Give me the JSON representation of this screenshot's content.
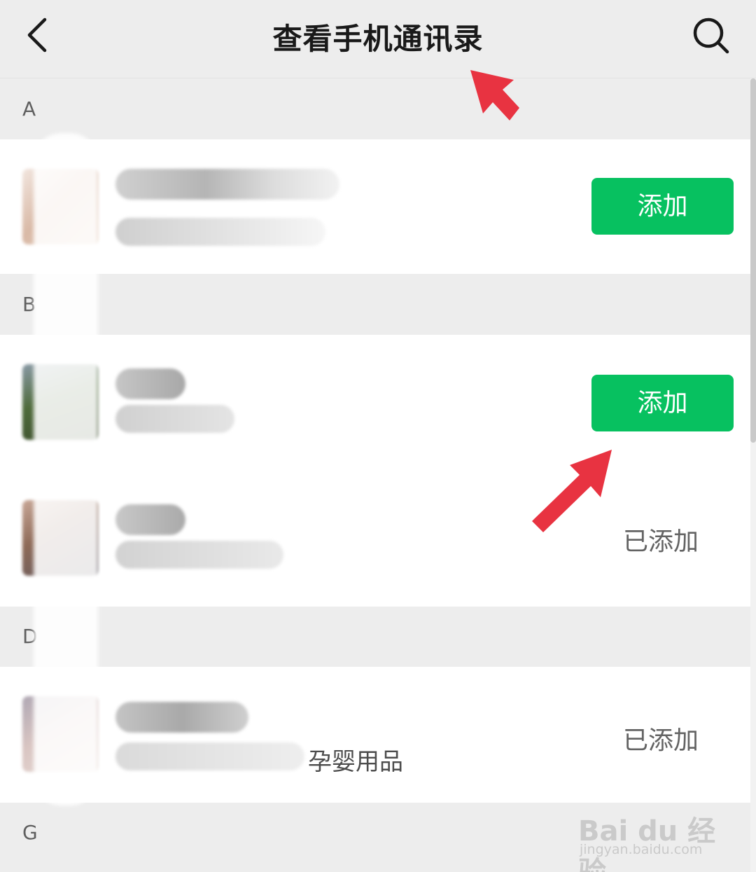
{
  "header": {
    "title": "查看手机通讯录",
    "back_icon": "chevron-left-icon",
    "search_icon": "search-icon"
  },
  "sections": [
    {
      "letter": "A"
    },
    {
      "letter": "B"
    },
    {
      "letter": "D"
    },
    {
      "letter": "G"
    }
  ],
  "contacts": [
    {
      "section": "A",
      "status": "add",
      "action_label": "添加"
    },
    {
      "section": "B",
      "status": "add",
      "action_label": "添加"
    },
    {
      "section": "B",
      "status": "added",
      "action_label": "已添加"
    },
    {
      "section": "D",
      "status": "added",
      "action_label": "已添加",
      "visible_sub": "孕婴用品"
    }
  ],
  "watermark": {
    "logo": "Bai du 经验",
    "url": "jingyan.baidu.com"
  },
  "colors": {
    "accent_green": "#07c160",
    "annotation_red": "#e83341",
    "background": "#ededed"
  }
}
